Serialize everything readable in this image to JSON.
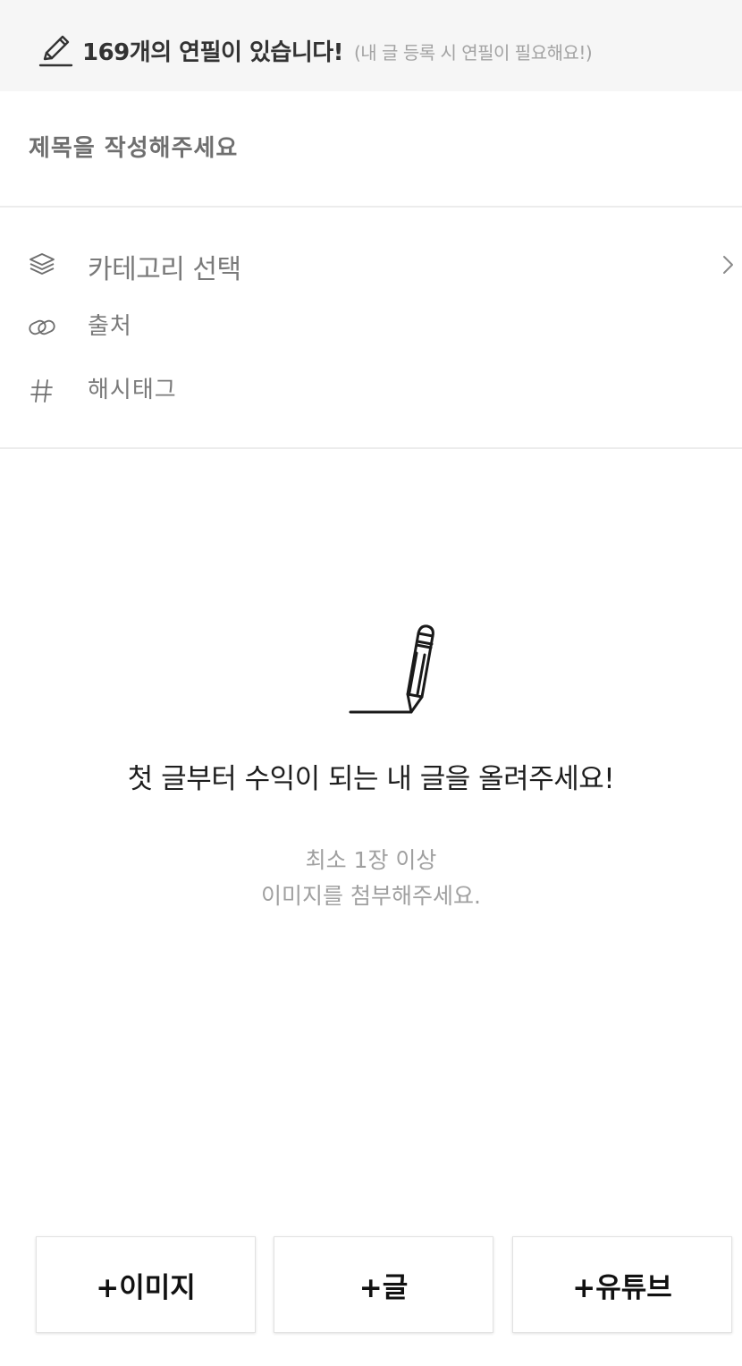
{
  "banner": {
    "icon": "pencil-icon",
    "main_text": "169개의 연필이 있습니다!",
    "sub_text": "(내 글 등록 시 연필이 필요해요!)"
  },
  "title_field": {
    "placeholder": "제목을 작성해주세요",
    "value": ""
  },
  "meta": {
    "category": {
      "icon": "layers-icon",
      "label": "카테고리 선택",
      "chevron_icon": "chevron-right-icon"
    },
    "source": {
      "icon": "link-icon",
      "placeholder": "출처"
    },
    "hashtag": {
      "icon": "hash-icon",
      "placeholder": "해시태그"
    }
  },
  "empty_state": {
    "illustration": "pencil-writing-icon",
    "headline": "첫 글부터 수익이 되는 내 글을 올려주세요!",
    "hint_line1": "최소 1장 이상",
    "hint_line2": "이미지를 첨부해주세요."
  },
  "actions": {
    "add_image": "+이미지",
    "add_text": "+글",
    "add_youtube": "+유튜브"
  },
  "colors": {
    "banner_bg": "#f6f6f6",
    "divider": "#ececec",
    "muted_text": "#a0a0a0",
    "label_text": "#7a7a7a"
  }
}
